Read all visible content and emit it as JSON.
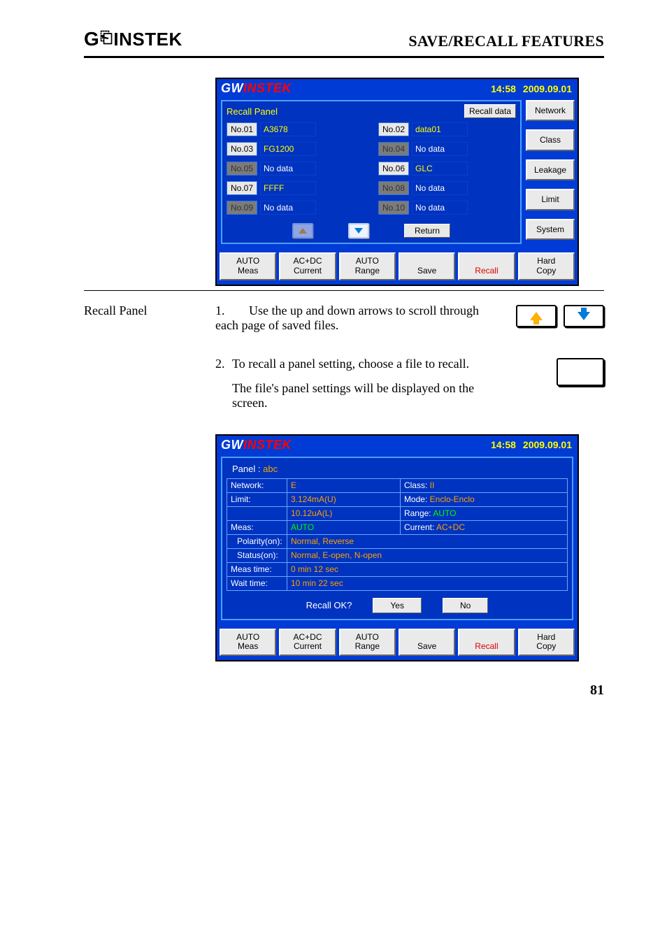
{
  "header": {
    "brand": "GWINSTEK",
    "section": "SAVE/RECALL FEATURES"
  },
  "side_label": "Recall Panel",
  "steps": {
    "s1": "Use the up and down arrows to scroll through each page of saved files.",
    "s2": "To recall a panel setting, choose a file to recall.",
    "s2b": "The file's panel settings will be displayed on the screen."
  },
  "device_header": {
    "time": "14:58",
    "date": "2009.09.01"
  },
  "side_buttons": {
    "network": "Network",
    "class": "Class",
    "leakage": "Leakage",
    "limit": "Limit",
    "system": "System"
  },
  "softkeys": {
    "k1a": "AUTO",
    "k1b": "Meas",
    "k2a": "AC+DC",
    "k2b": "Current",
    "k3a": "AUTO",
    "k3b": "Range",
    "k4": "Save",
    "k5": "Recall",
    "k6a": "Hard",
    "k6b": "Copy"
  },
  "recall_panel": {
    "title": "Recall Panel",
    "recall_data_btn": "Recall data",
    "return_btn": "Return",
    "slots": [
      {
        "no": "No.01",
        "name": "A3678",
        "active": true
      },
      {
        "no": "No.02",
        "name": "data01",
        "active": true
      },
      {
        "no": "No.03",
        "name": "FG1200",
        "active": true
      },
      {
        "no": "No.04",
        "name": "No data",
        "active": false
      },
      {
        "no": "No.05",
        "name": "No data",
        "active": false
      },
      {
        "no": "No.06",
        "name": "GLC",
        "active": true
      },
      {
        "no": "No.07",
        "name": "FFFF",
        "active": true
      },
      {
        "no": "No.08",
        "name": "No data",
        "active": false
      },
      {
        "no": "No.09",
        "name": "No data",
        "active": false
      },
      {
        "no": "No.10",
        "name": "No data",
        "active": false
      }
    ]
  },
  "settings": {
    "panel_label": "Panel :",
    "panel_name": "abc",
    "rows": {
      "network_k": "Network:",
      "network_v": "E",
      "class_k": "Class:",
      "class_v": "II",
      "limit_k": "Limit:",
      "limit_u": "3.124mA(U)",
      "mode_k": "Mode:",
      "mode_v": "Enclo-Enclo",
      "limit_l": "10.12uA(L)",
      "range_k": "Range:",
      "range_v": "AUTO",
      "meas_k": "Meas:",
      "meas_v": "AUTO",
      "current_k": "Current:",
      "current_v": "AC+DC",
      "polarity_k": "Polarity(on):",
      "polarity_v": "Normal, Reverse",
      "status_k": "Status(on):",
      "status_v": "Normal, E-open, N-open",
      "meastime_k": "Meas time:",
      "meastime_v": "0 min 12 sec",
      "waittime_k": "Wait time:",
      "waittime_v": "10 min 22 sec"
    },
    "recall_ok": "Recall OK?",
    "yes": "Yes",
    "no": "No"
  },
  "page_number": "81"
}
